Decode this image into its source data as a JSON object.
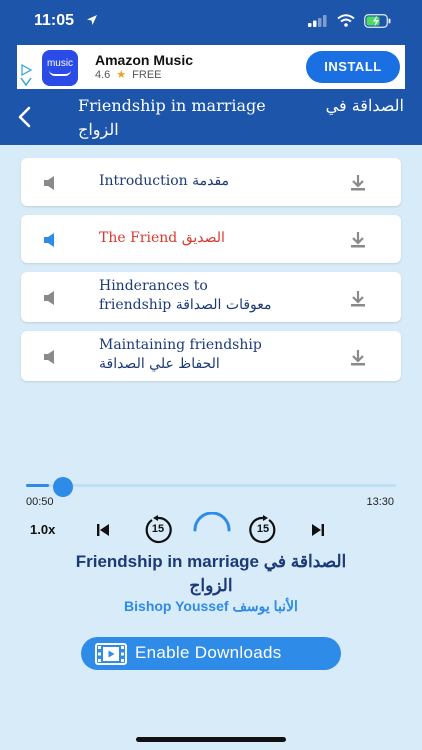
{
  "status_bar": {
    "time": "11:05"
  },
  "ad": {
    "logo_text": "music",
    "app_name": "Amazon Music",
    "rating": "4.6",
    "price": "FREE",
    "install_label": "INSTALL"
  },
  "header": {
    "title_en": "Friendship in marriage",
    "title_ar_1": "الصداقة في",
    "title_ar_2": "الزواج"
  },
  "tracks": [
    {
      "en": "Introduction",
      "ar": "مقدمة",
      "active": false
    },
    {
      "en": "The Friend",
      "ar": "الصديق",
      "active": true
    },
    {
      "en": "Hinderances to",
      "en2": "friendship",
      "ar": "معوقات الصداقة",
      "active": false
    },
    {
      "en": "Maintaining friendship",
      "ar": "الحفاظ علي الصداقة",
      "active": false
    }
  ],
  "player": {
    "elapsed": "00:50",
    "duration": "13:30",
    "progress": 0.062,
    "speed": "1.0x",
    "skip_back_seconds": "15",
    "skip_forward_seconds": "15",
    "title_en": "Friendship in marriage",
    "title_ar_1": "الصداقة في",
    "title_ar_2": "الزواج",
    "author_en": "Bishop Youssef",
    "author_ar": "الأنبا يوسف"
  },
  "enable_downloads_label": "Enable Downloads",
  "colors": {
    "header_bg": "#1c55aa",
    "page_bg": "#d8ebf8",
    "accent": "#2f8be8",
    "active_track": "#d8392f",
    "track_text": "#1c3a78"
  }
}
